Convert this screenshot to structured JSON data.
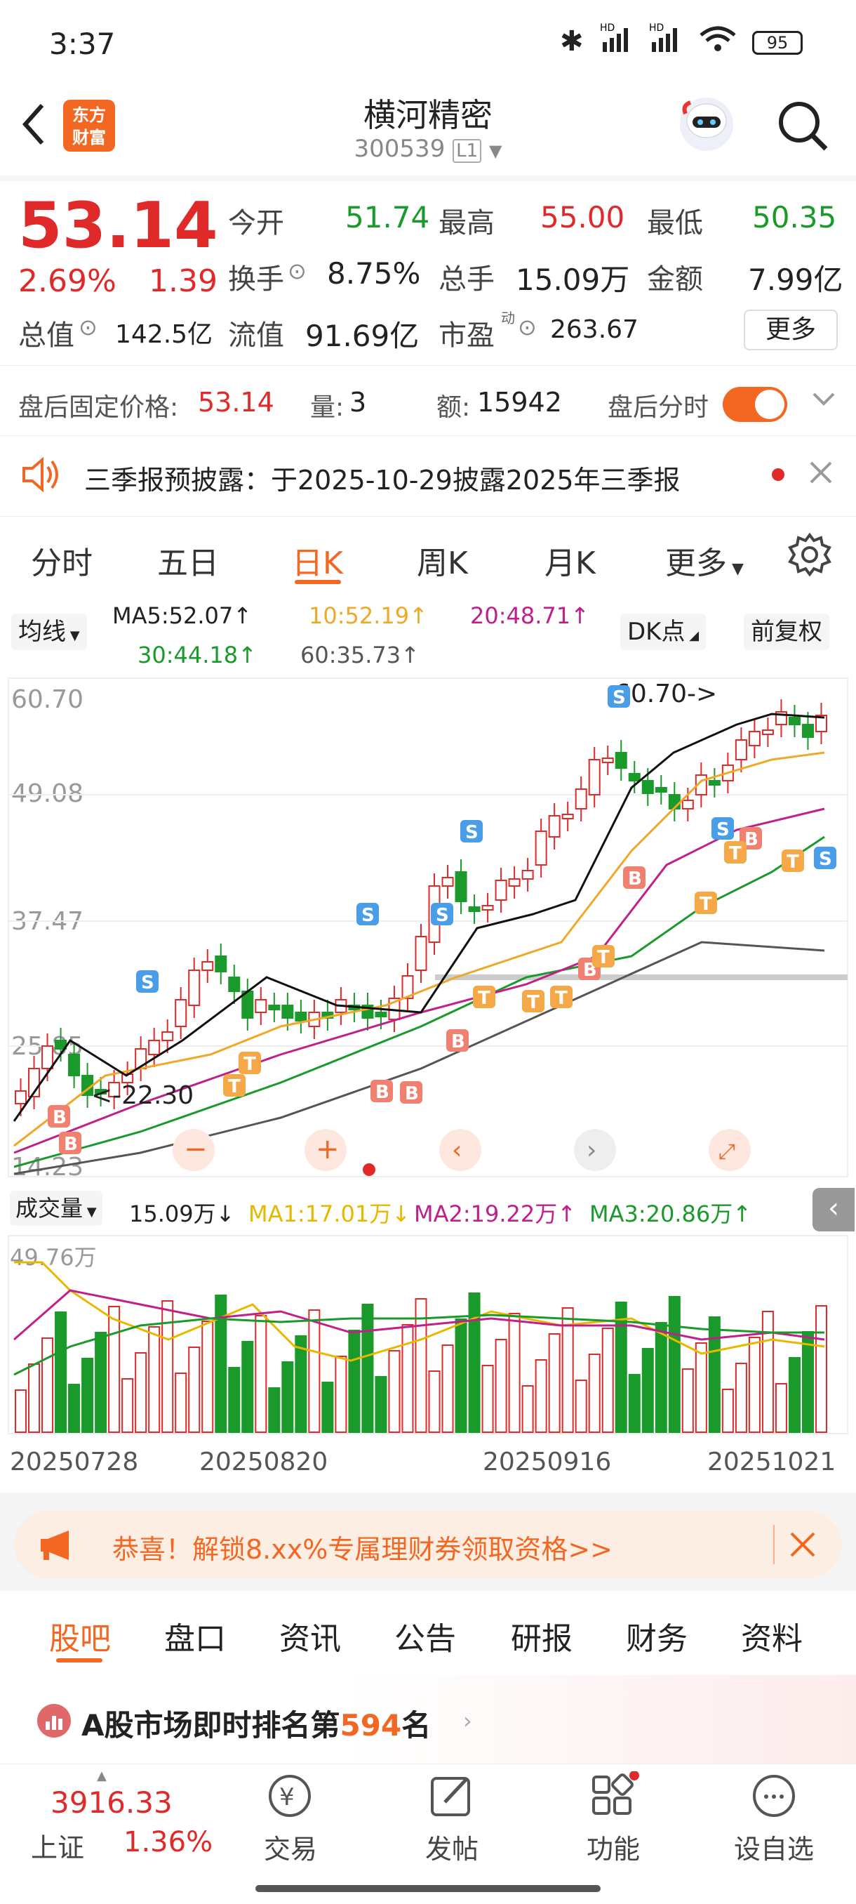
{
  "status": {
    "time": "3:37",
    "battery": "95",
    "hd1": "HD",
    "hd2": "HD"
  },
  "header": {
    "logo_line1": "东方",
    "logo_line2": "财富",
    "title": "横河精密",
    "code": "300539",
    "level": "L1"
  },
  "quote": {
    "price": "53.14",
    "change_pct": "2.69%",
    "change_amt": "1.39",
    "open_label": "今开",
    "open": "51.74",
    "high_label": "最高",
    "high": "55.00",
    "low_label": "最低",
    "low": "50.35",
    "turnover_label": "换手",
    "turnover": "8.75%",
    "volume_label": "总手",
    "volume": "15.09万",
    "amount_label": "金额",
    "amount": "7.99亿",
    "mktcap_label": "总值",
    "mktcap": "142.5亿",
    "float_label": "流值",
    "float": "91.69亿",
    "pe_label": "市盈",
    "pe_sup": "动",
    "pe": "263.67",
    "more": "更多"
  },
  "afterhours": {
    "price_label": "盘后固定价格:",
    "price": "53.14",
    "qty_label": "量:",
    "qty": "3",
    "amt_label": "额:",
    "amt": "15942",
    "timeshare_label": "盘后分时"
  },
  "notice": {
    "text": "三季报预披露：于2025-10-29披露2025年三季报"
  },
  "tabs": [
    "分时",
    "五日",
    "日K",
    "周K",
    "月K",
    "更多"
  ],
  "ma": {
    "selector": "均线",
    "ma5": "MA5:52.07↑",
    "ma10": "10:52.19↑",
    "ma20": "20:48.71↑",
    "ma30": "30:44.18↑",
    "ma60": "60:35.73↑",
    "dk": "DK点",
    "fq": "前复权"
  },
  "chart": {
    "y_labels": [
      "60.70",
      "49.08",
      "37.47",
      "25.85",
      "14.23"
    ],
    "max_note": "60.70->",
    "min_note": "<-22.30"
  },
  "volume": {
    "selector": "成交量",
    "vol": "15.09万↓",
    "ma1": "MA1:17.01万↓",
    "ma2": "MA2:19.22万↑",
    "ma3": "MA3:20.86万↑",
    "y_label": "49.76万"
  },
  "dates": [
    "20250728",
    "20250820",
    "20250916",
    "20251021"
  ],
  "ad": {
    "text": "恭喜！解锁8.xx%专属理财券领取资格>>"
  },
  "subtabs": [
    "股吧",
    "盘口",
    "资讯",
    "公告",
    "研报",
    "财务",
    "资料"
  ],
  "rank": {
    "prefix": "A股市场即时排名第",
    "num": "594",
    "suffix": "名"
  },
  "bottom": {
    "index_value": "3916.33",
    "index_name": "上证",
    "index_pct": "1.36%",
    "trade": "交易",
    "post": "发帖",
    "func": "功能",
    "watch": "设自选"
  },
  "colors": {
    "up": "#e02a2a",
    "down": "#1a9a2a",
    "accent": "#f26722"
  },
  "chart_data": {
    "type": "candlestick",
    "y_range": [
      14.23,
      60.7
    ],
    "x_dates": [
      "20250728",
      "20250820",
      "20250916",
      "20251021"
    ],
    "max": 60.7,
    "min": 22.3,
    "ma": {
      "MA5": 52.07,
      "MA10": 52.19,
      "MA20": 48.71,
      "MA30": 44.18,
      "MA60": 35.73
    }
  }
}
